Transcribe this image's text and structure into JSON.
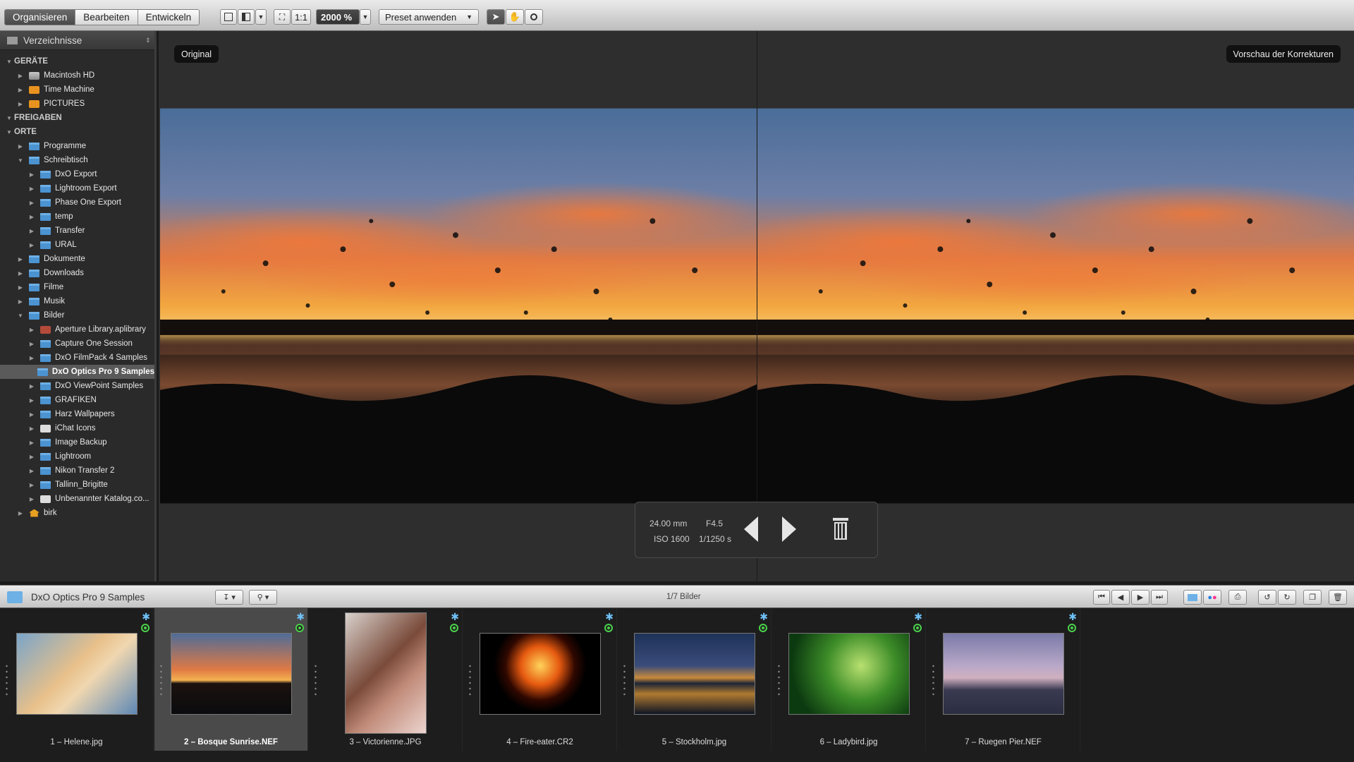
{
  "toolbar": {
    "modes": [
      "Organisieren",
      "Bearbeiten",
      "Entwickeln"
    ],
    "one_to_one": "1:1",
    "zoom": "2000 %",
    "preset": "Preset anwenden"
  },
  "sidebar": {
    "header": "Verzeichnisse",
    "rows": [
      {
        "label": "GERÄTE",
        "level": 0,
        "section": true,
        "icon": "",
        "expanded": true
      },
      {
        "label": "Macintosh HD",
        "level": 1,
        "icon": "drive",
        "expanded": false
      },
      {
        "label": "Time Machine",
        "level": 1,
        "icon": "orange",
        "expanded": false
      },
      {
        "label": "PICTURES",
        "level": 1,
        "icon": "orange",
        "expanded": false
      },
      {
        "label": "FREIGABEN",
        "level": 0,
        "section": true,
        "icon": "",
        "expanded": true
      },
      {
        "label": "ORTE",
        "level": 0,
        "section": true,
        "icon": "",
        "expanded": true
      },
      {
        "label": "Programme",
        "level": 1,
        "icon": "folder",
        "expanded": false
      },
      {
        "label": "Schreibtisch",
        "level": 1,
        "icon": "folder",
        "expanded": true
      },
      {
        "label": "DxO Export",
        "level": 2,
        "icon": "folder",
        "expanded": false
      },
      {
        "label": "Lightroom Export",
        "level": 2,
        "icon": "folder",
        "expanded": false
      },
      {
        "label": "Phase One Export",
        "level": 2,
        "icon": "folder",
        "expanded": false
      },
      {
        "label": "temp",
        "level": 2,
        "icon": "folder",
        "expanded": false
      },
      {
        "label": "Transfer",
        "level": 2,
        "icon": "folder",
        "expanded": false
      },
      {
        "label": "URAL",
        "level": 2,
        "icon": "folder",
        "expanded": false
      },
      {
        "label": "Dokumente",
        "level": 1,
        "icon": "folder",
        "expanded": false
      },
      {
        "label": "Downloads",
        "level": 1,
        "icon": "folder",
        "expanded": false
      },
      {
        "label": "Filme",
        "level": 1,
        "icon": "folder",
        "expanded": false
      },
      {
        "label": "Musik",
        "level": 1,
        "icon": "folder",
        "expanded": false
      },
      {
        "label": "Bilder",
        "level": 1,
        "icon": "folder",
        "expanded": true
      },
      {
        "label": "Aperture Library.aplibrary",
        "level": 2,
        "icon": "lib",
        "expanded": false
      },
      {
        "label": "Capture One Session",
        "level": 2,
        "icon": "folder",
        "expanded": false
      },
      {
        "label": "DxO FilmPack 4 Samples",
        "level": 2,
        "icon": "folder",
        "expanded": false
      },
      {
        "label": "DxO Optics Pro 9 Samples",
        "level": 2,
        "icon": "folder",
        "expanded": false,
        "selected": true,
        "leaf": true
      },
      {
        "label": "DxO ViewPoint Samples",
        "level": 2,
        "icon": "folder",
        "expanded": false
      },
      {
        "label": "GRAFIKEN",
        "level": 2,
        "icon": "folder",
        "expanded": false
      },
      {
        "label": "Harz Wallpapers",
        "level": 2,
        "icon": "folder",
        "expanded": false
      },
      {
        "label": "iChat Icons",
        "level": 2,
        "icon": "white",
        "expanded": false
      },
      {
        "label": "Image Backup",
        "level": 2,
        "icon": "folder",
        "expanded": false
      },
      {
        "label": "Lightroom",
        "level": 2,
        "icon": "folder",
        "expanded": false
      },
      {
        "label": "Nikon Transfer 2",
        "level": 2,
        "icon": "folder",
        "expanded": false
      },
      {
        "label": "Tallinn_Brigitte",
        "level": 2,
        "icon": "folder",
        "expanded": false
      },
      {
        "label": "Unbenannter Katalog.co...",
        "level": 2,
        "icon": "white",
        "expanded": false
      },
      {
        "label": "birk",
        "level": 1,
        "icon": "home",
        "expanded": false
      }
    ]
  },
  "viewer": {
    "left_label": "Original",
    "right_label": "Vorschau der Korrekturen"
  },
  "info": {
    "focal": "24.00 mm",
    "aperture": "F4.5",
    "iso": "ISO 1600",
    "shutter": "1/1250 s"
  },
  "filmbar": {
    "folder": "DxO Optics Pro 9 Samples",
    "count": "1/7 Bilder"
  },
  "thumbnails": [
    {
      "caption": "1 – Helene.jpg",
      "orient": "land",
      "selected": false
    },
    {
      "caption": "2 – Bosque Sunrise.NEF",
      "orient": "land",
      "selected": true
    },
    {
      "caption": "3 – Victorienne.JPG",
      "orient": "port",
      "selected": false
    },
    {
      "caption": "4 – Fire-eater.CR2",
      "orient": "land",
      "selected": false
    },
    {
      "caption": "5 – Stockholm.jpg",
      "orient": "land",
      "selected": false
    },
    {
      "caption": "6 – Ladybird.jpg",
      "orient": "land",
      "selected": false
    },
    {
      "caption": "7 – Ruegen Pier.NEF",
      "orient": "land",
      "selected": false
    }
  ]
}
